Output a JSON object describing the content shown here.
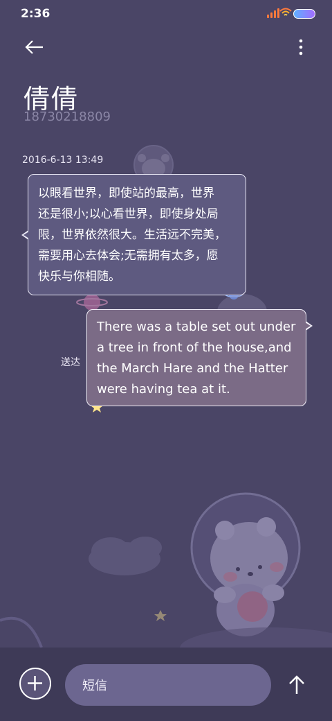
{
  "status_bar": {
    "time": "2:36"
  },
  "header": {
    "contact_name": "倩倩",
    "contact_number": "18730218809"
  },
  "icons": {
    "back": "back-arrow-icon",
    "more": "more-vertical-icon",
    "attach": "attach-plus-icon",
    "send": "send-arrow-up-icon"
  },
  "conversation": {
    "timestamp": "2016-6-13 13:49",
    "messages": [
      {
        "direction": "incoming",
        "text": "以眼看世界，即使站的最高，世界还是很小;以心看世界，即使身处局限，世界依然很大。生活远不完美，需要用心去体会;无需拥有太多，愿快乐与你相随。",
        "lines": [
          "以眼看世界，即使站的最高，世界",
          "还是很小;以心看世界，即使身处局",
          "限，世界依然很大。生活远不完美，",
          "需要用心去体会;无需拥有太多，愿",
          "快乐与你相随。"
        ]
      },
      {
        "direction": "outgoing",
        "status": "送达",
        "text": "There was a table set out under a tree in front of the house,and the March Hare and the Hatter were having tea at it.",
        "lines": [
          "There was a table set out under",
          "a tree in front of the house,and",
          "the March Hare and the Hatter",
          "were having tea at it."
        ]
      }
    ]
  },
  "composer": {
    "placeholder": "短信"
  },
  "colors": {
    "background": "#4a4566",
    "incoming_bubble": "#5e5a80",
    "outgoing_bubble": "#7b6b86",
    "bottom_bar": "#3e3a57"
  }
}
